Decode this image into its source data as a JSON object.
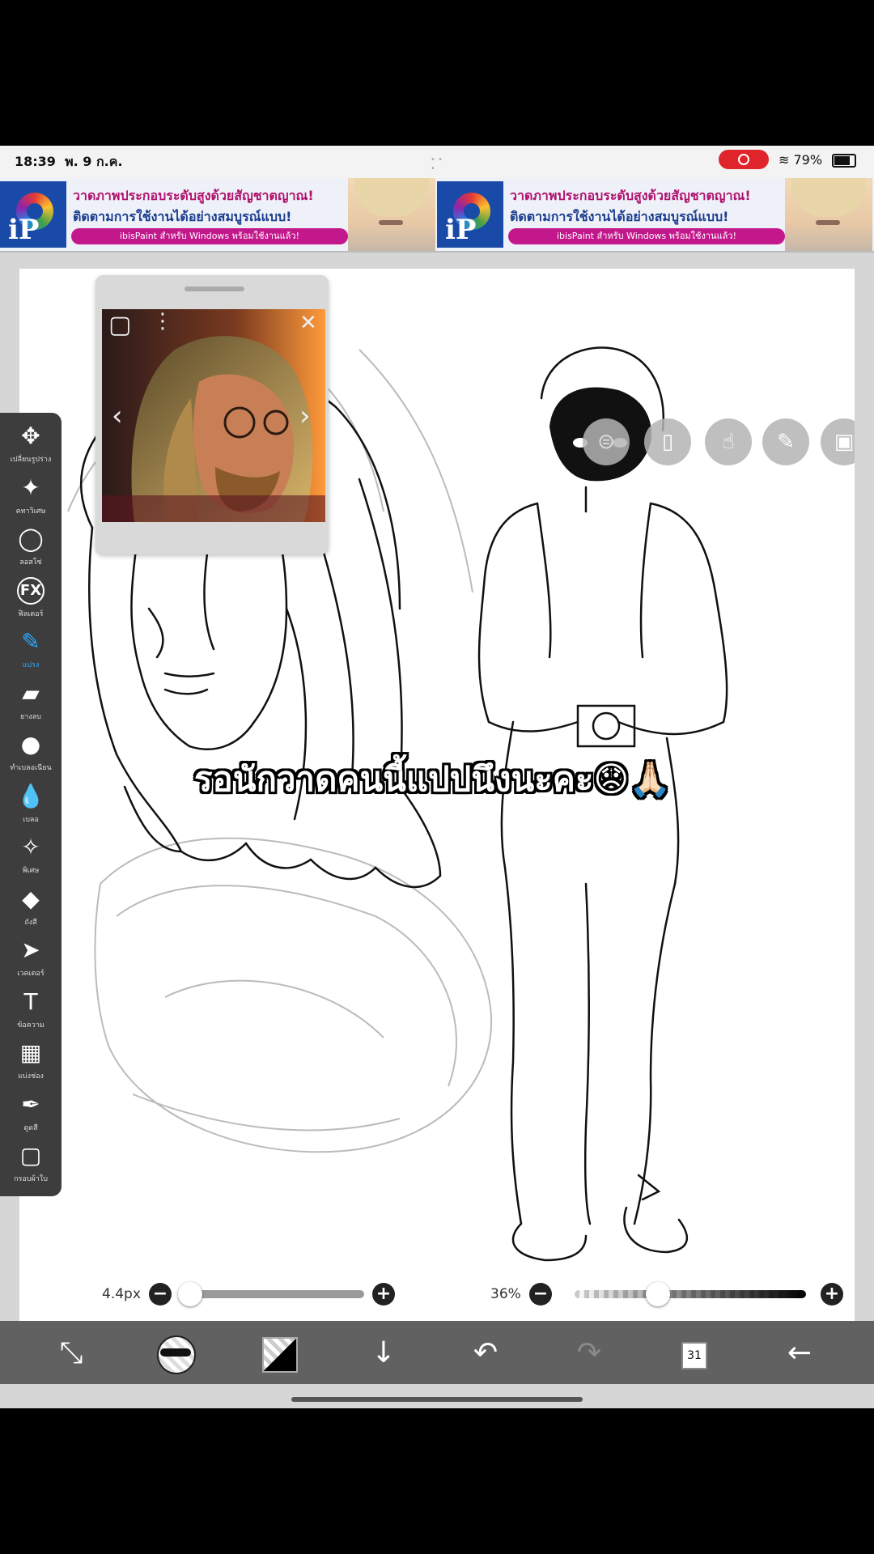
{
  "status_bar": {
    "time": "18:39",
    "date": "พ. 9 ก.ค.",
    "battery": "79%",
    "wifi_icon": "wifi-icon",
    "record_icon": "screen-record-icon"
  },
  "ad": {
    "line1": "วาดภาพประกอบระดับสูงด้วยสัญชาตญาณ!",
    "line2": "ติดตามการใช้งานได้อย่างสมบูรณ์แบบ!",
    "pill": "ibisPaint สำหรับ Windows พร้อมใช้งานแล้ว!",
    "logo_text": "iP"
  },
  "reference": {
    "close_icon": "close-icon",
    "prev_icon": "chevron-left-icon",
    "next_icon": "chevron-right-icon"
  },
  "toolbar": {
    "items": [
      {
        "icon": "move-icon",
        "glyph": "✥",
        "label": "เปลี่ยนรูปร่าง"
      },
      {
        "icon": "magic-wand-icon",
        "glyph": "✦",
        "label": "คทาวิเศษ"
      },
      {
        "icon": "lasso-icon",
        "glyph": "◯",
        "label": "ลอสโซ่"
      },
      {
        "icon": "fx-icon",
        "glyph": "FX",
        "label": "ฟิลเตอร์"
      },
      {
        "icon": "brush-icon",
        "glyph": "✎",
        "label": "แปรง"
      },
      {
        "icon": "eraser-icon",
        "glyph": "▰",
        "label": "ยางลบ"
      },
      {
        "icon": "smudge-icon",
        "glyph": "●",
        "label": "ทำเบลอเนียน"
      },
      {
        "icon": "blur-drop-icon",
        "glyph": "💧",
        "label": "เบลอ"
      },
      {
        "icon": "special-brush-icon",
        "glyph": "✧",
        "label": "พิเศษ"
      },
      {
        "icon": "fill-icon",
        "glyph": "◆",
        "label": "ถังสี"
      },
      {
        "icon": "vector-icon",
        "glyph": "➤",
        "label": "เวคเตอร์"
      },
      {
        "icon": "text-icon",
        "glyph": "T",
        "label": "ข้อความ"
      },
      {
        "icon": "frame-divider-icon",
        "glyph": "▦",
        "label": "แบ่งช่อง"
      },
      {
        "icon": "eyedropper-icon",
        "glyph": "✒",
        "label": "ดูดสี"
      },
      {
        "icon": "canvas-icon",
        "glyph": "▢",
        "label": "กรอบผ้าใบ"
      }
    ]
  },
  "top_buttons": [
    {
      "icon": "toggle-icon",
      "glyph": "⊜"
    },
    {
      "icon": "material-icon",
      "glyph": "▯"
    },
    {
      "icon": "hand-icon",
      "glyph": "☝"
    },
    {
      "icon": "pencil-icon",
      "glyph": "✎"
    },
    {
      "icon": "image-icon",
      "glyph": "▣"
    }
  ],
  "caption": "รอนักวาดคนนี้แปปนึงนะคะ😞🙏🏻",
  "brush_size": {
    "label": "4.4px",
    "value_fraction": 0.0
  },
  "opacity": {
    "label": "36%",
    "value_fraction": 0.36
  },
  "bottom_bar": {
    "layer_count": "31",
    "items": [
      {
        "icon": "transform-icon",
        "glyph": "⤡"
      },
      {
        "icon": "brush-preview-icon",
        "glyph": ""
      },
      {
        "icon": "color-swatch-icon",
        "glyph": ""
      },
      {
        "icon": "download-arrow-icon",
        "glyph": "↓"
      },
      {
        "icon": "undo-icon",
        "glyph": "↶"
      },
      {
        "icon": "redo-icon",
        "glyph": "↷"
      },
      {
        "icon": "layers-icon",
        "glyph": ""
      },
      {
        "icon": "back-arrow-icon",
        "glyph": "←"
      }
    ]
  }
}
